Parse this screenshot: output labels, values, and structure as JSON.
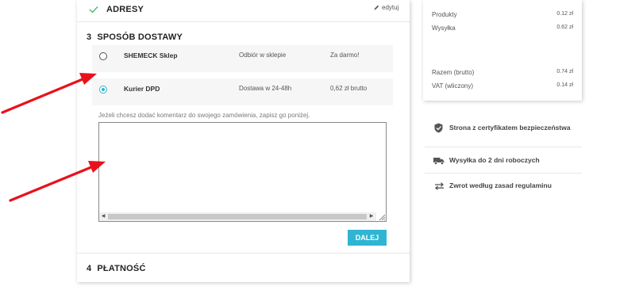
{
  "steps": {
    "addresses": {
      "title": "ADRESY",
      "edit_label": "edytuj"
    },
    "delivery": {
      "number": "3",
      "title": "SPOSÓB DOSTAWY",
      "carriers": [
        {
          "name": "SHEMECK Sklep",
          "delay": "Odbiór w sklepie",
          "price": "Za darmo!",
          "selected": false
        },
        {
          "name": "Kurier DPD",
          "delay": "Dostawa w 24-48h",
          "price": "0,62 zł brutto",
          "selected": true
        }
      ],
      "comment_label": "Jeżeli chcesz dodać komentarz do swojego zamówienia, zapisz go poniżej.",
      "comment_value": "",
      "next_label": "DALEJ"
    },
    "payment": {
      "number": "4",
      "title": "PŁATNOŚĆ"
    }
  },
  "summary": {
    "products_label": "Produkty",
    "products_value": "0.12 zł",
    "shipping_label": "Wysyłka",
    "shipping_value": "0.62 zł",
    "total_label": "Razem (brutto)",
    "total_value": "0.74 zł",
    "vat_label": "VAT (wliczony)",
    "vat_value": "0.14 zł"
  },
  "reassurance": [
    {
      "icon": "shield-check-icon",
      "text": "Strona z certyfikatem bezpieczeństwa"
    },
    {
      "icon": "truck-icon",
      "text": "Wysyłka do 2 dni roboczych"
    },
    {
      "icon": "exchange-arrows-icon",
      "text": "Zwrot według zasad regulaminu"
    }
  ],
  "colors": {
    "accent": "#2fb5d2",
    "annotation_arrow": "#e8121b",
    "check": "#4cbb6c"
  }
}
